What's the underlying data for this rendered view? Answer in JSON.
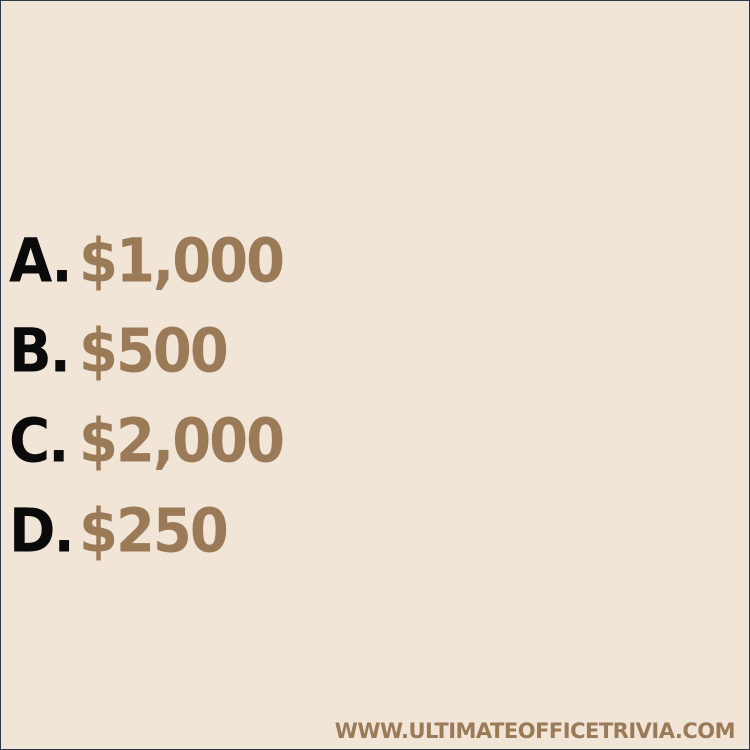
{
  "options": [
    {
      "letter": "A.",
      "value": "$1,000"
    },
    {
      "letter": "B.",
      "value": "$500"
    },
    {
      "letter": "C.",
      "value": "$2,000"
    },
    {
      "letter": "D.",
      "value": "$250"
    }
  ],
  "footer": {
    "url": "WWW.ULTIMATEOFFICETRIVIA.COM"
  },
  "colors": {
    "background": "#f0e5d6",
    "letter": "#0a0a0a",
    "accent": "#9b7a58"
  }
}
